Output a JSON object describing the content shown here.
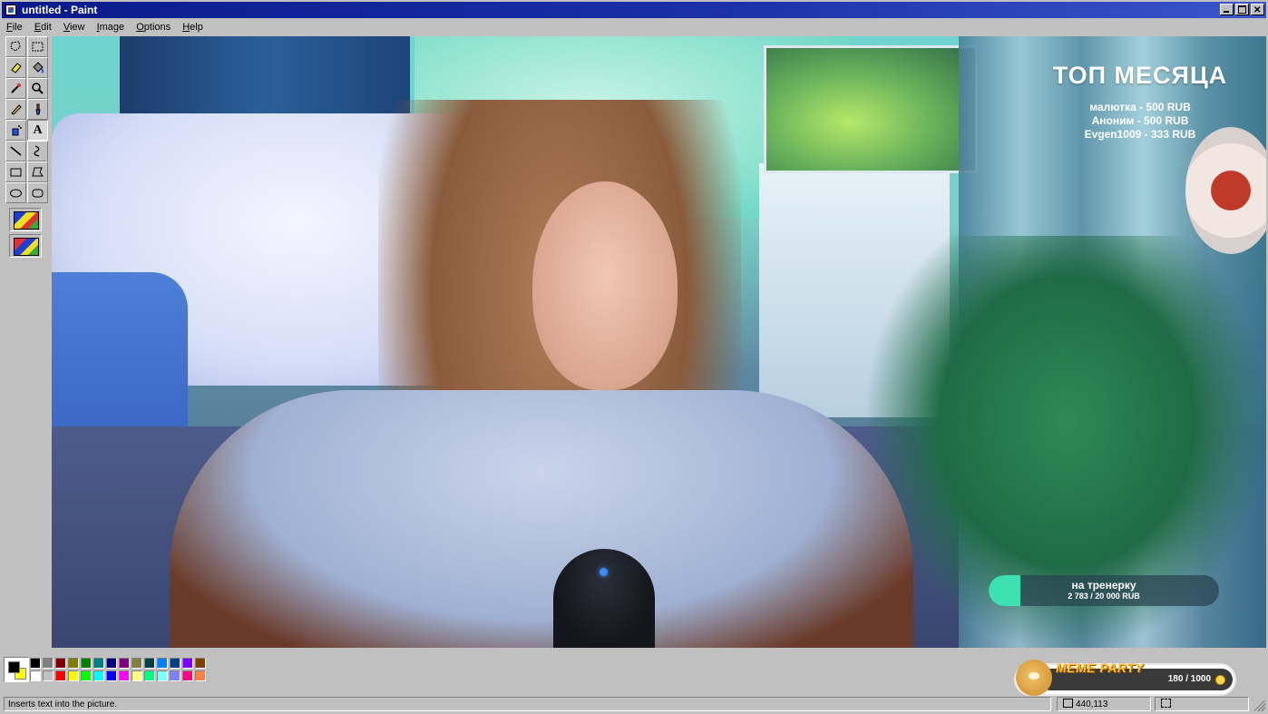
{
  "window": {
    "title": "untitled - Paint"
  },
  "menu": {
    "items": [
      "File",
      "Edit",
      "View",
      "Image",
      "Options",
      "Help"
    ]
  },
  "tools": {
    "items": [
      {
        "icon": "free-select-icon"
      },
      {
        "icon": "rect-select-icon"
      },
      {
        "icon": "eraser-icon"
      },
      {
        "icon": "fill-icon"
      },
      {
        "icon": "color-picker-icon"
      },
      {
        "icon": "magnifier-icon"
      },
      {
        "icon": "pencil-icon"
      },
      {
        "icon": "brush-icon"
      },
      {
        "icon": "airbrush-icon"
      },
      {
        "icon": "text-icon",
        "glyph": "A",
        "active": true
      },
      {
        "icon": "line-icon"
      },
      {
        "icon": "curve-icon"
      },
      {
        "icon": "rectangle-icon"
      },
      {
        "icon": "polygon-icon"
      },
      {
        "icon": "ellipse-icon"
      },
      {
        "icon": "rounded-rect-icon"
      }
    ]
  },
  "overlay": {
    "top_month": {
      "title": "ТОП МЕСЯЦА",
      "entries": [
        "малютка - 500 RUB",
        "Аноним - 500 RUB",
        "Evgen1009 - 333 RUB"
      ]
    },
    "goal": {
      "title": "на тренерку",
      "amount": "2 783 / 20 000 RUB",
      "progress": 0.139
    }
  },
  "palette": {
    "foreground": "#000000",
    "background": "#ffff00",
    "colors": [
      "#000000",
      "#808080",
      "#800000",
      "#808000",
      "#008000",
      "#008080",
      "#000080",
      "#800080",
      "#808040",
      "#004040",
      "#0080ff",
      "#004080",
      "#8000ff",
      "#804000",
      "#ffffff",
      "#c0c0c0",
      "#ff0000",
      "#ffff00",
      "#00ff00",
      "#00ffff",
      "#0000ff",
      "#ff00ff",
      "#ffff80",
      "#00ff80",
      "#80ffff",
      "#8080ff",
      "#ff0080",
      "#ff8040"
    ]
  },
  "widget": {
    "title": "MEME PARTY",
    "count": "180 / 1000"
  },
  "status": {
    "message": "Inserts text into the picture.",
    "coords": "440,113",
    "size": ""
  }
}
